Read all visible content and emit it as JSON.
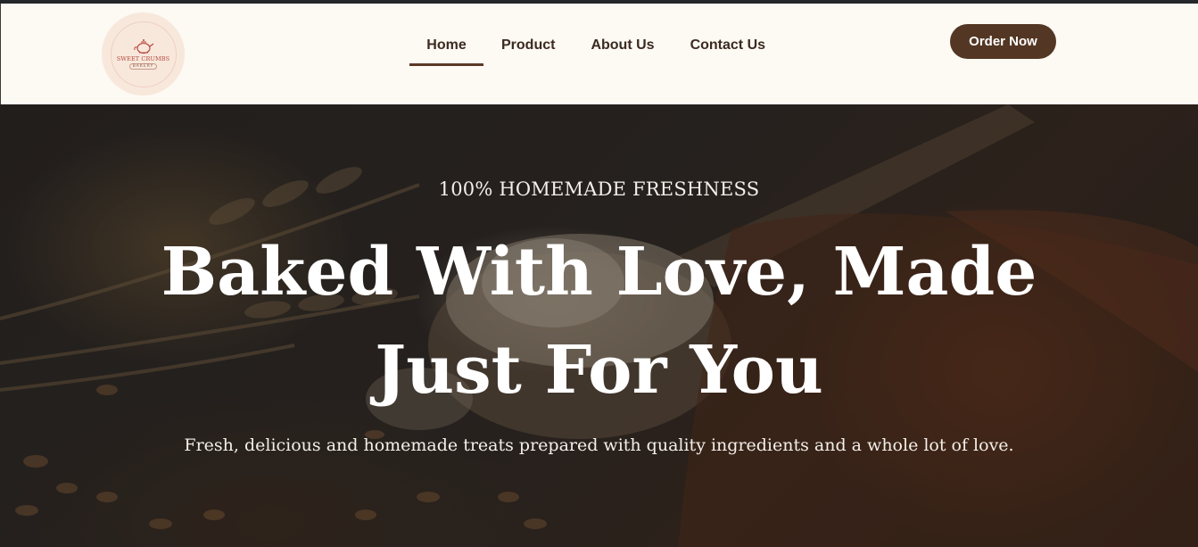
{
  "header": {
    "logo": {
      "title": "SWEET CRUMBS",
      "subtitle": "BAKERY",
      "icon": "teapot-icon"
    },
    "nav": [
      {
        "label": "Home",
        "active": true
      },
      {
        "label": "Product",
        "active": false
      },
      {
        "label": "About Us",
        "active": false
      },
      {
        "label": "Contact Us",
        "active": false
      }
    ],
    "cta_label": "Order Now"
  },
  "hero": {
    "eyebrow": "100% HOMEMADE FRESHNESS",
    "headline": "Baked With Love, Made Just For You",
    "subline": "Fresh, delicious and homemade treats prepared with quality ingredients and a whole lot of love."
  },
  "colors": {
    "header_bg": "#fdf9f3",
    "brand_brown": "#533623",
    "nav_text": "#3b2a20",
    "hero_text": "#ffffff"
  }
}
